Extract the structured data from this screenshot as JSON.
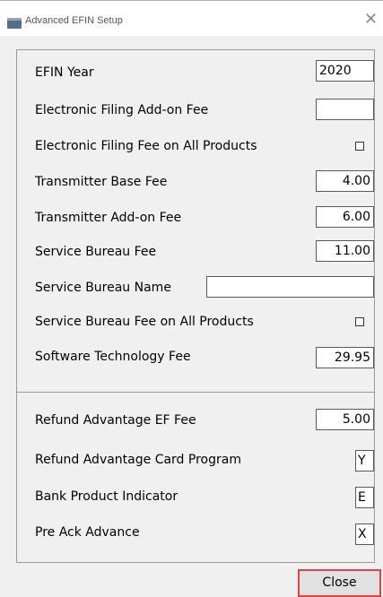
{
  "window": {
    "title": "Advanced EFIN Setup",
    "close_glyph": "✕"
  },
  "fields": {
    "efin_year": {
      "label": "EFIN Year",
      "value": "2020"
    },
    "ef_addon_fee": {
      "label": "Electronic Filing Add-on Fee",
      "value": ""
    },
    "ef_fee_all_products": {
      "label": "Electronic Filing Fee on All Products",
      "checked": false
    },
    "transmitter_base_fee": {
      "label": "Transmitter Base Fee",
      "value": "4.00"
    },
    "transmitter_addon_fee": {
      "label": "Transmitter Add-on Fee",
      "value": "6.00"
    },
    "service_bureau_fee": {
      "label": "Service Bureau Fee",
      "value": "11.00"
    },
    "service_bureau_name": {
      "label": "Service Bureau Name",
      "value": ""
    },
    "sb_fee_all_products": {
      "label": "Service Bureau Fee on All Products",
      "checked": false
    },
    "software_tech_fee": {
      "label": "Software Technology Fee",
      "value": "29.95"
    },
    "refund_adv_ef_fee": {
      "label": "Refund Advantage EF Fee",
      "value": "5.00"
    },
    "refund_adv_card": {
      "label": "Refund Advantage Card Program",
      "value": "Y"
    },
    "bank_product_indicator": {
      "label": "Bank Product Indicator",
      "value": "E"
    },
    "pre_ack_advance": {
      "label": "Pre Ack Advance",
      "value": "X"
    }
  },
  "buttons": {
    "close_label": "Close"
  },
  "colors": {
    "highlight_border": "#e04545",
    "dialog_bg": "#f0f0f0"
  }
}
